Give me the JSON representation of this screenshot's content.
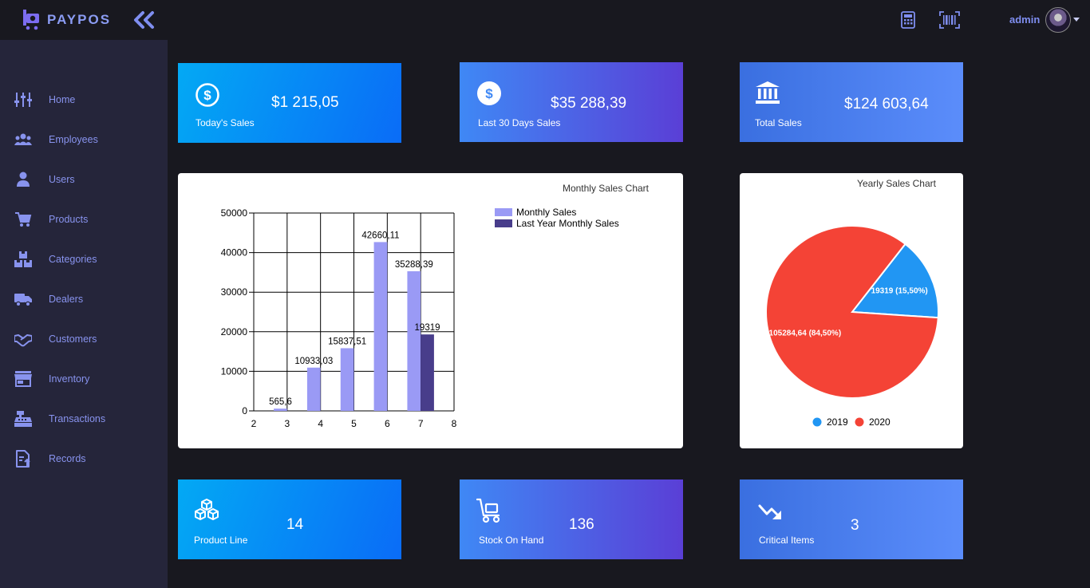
{
  "app": {
    "brand": "PAYPOS"
  },
  "topbar": {
    "user_name": "admin",
    "icons": [
      "calculator-icon",
      "barcode-icon"
    ]
  },
  "sidebar": {
    "items": [
      {
        "label": "Home",
        "icon": "sliders-icon"
      },
      {
        "label": "Employees",
        "icon": "people-icon"
      },
      {
        "label": "Users",
        "icon": "person-icon"
      },
      {
        "label": "Products",
        "icon": "cart-icon"
      },
      {
        "label": "Categories",
        "icon": "boxes-icon"
      },
      {
        "label": "Dealers",
        "icon": "truck-icon"
      },
      {
        "label": "Customers",
        "icon": "handshake-icon"
      },
      {
        "label": "Inventory",
        "icon": "store-icon"
      },
      {
        "label": "Transactions",
        "icon": "cash-register-icon"
      },
      {
        "label": "Records",
        "icon": "file-upload-icon"
      }
    ]
  },
  "cards_top": [
    {
      "label": "Today's Sales",
      "value": "$1 215,05",
      "icon": "dollar-circle-icon"
    },
    {
      "label": "Last 30 Days Sales",
      "value": "$35 288,39",
      "icon": "dollar-coin-icon"
    },
    {
      "label": "Total Sales",
      "value": "$124 603,64",
      "icon": "bank-icon"
    }
  ],
  "cards_bottom": [
    {
      "label": "Product Line",
      "value": "14",
      "icon": "cubes-icon"
    },
    {
      "label": "Stock On Hand",
      "value": "136",
      "icon": "dolly-icon"
    },
    {
      "label": "Critical Items",
      "value": "3",
      "icon": "trend-down-icon"
    }
  ],
  "colors": {
    "page_bg": "#18181f",
    "sidebar_bg": "#25253a",
    "nav_text": "#8893ee",
    "bar_monthly": "#9a9af5",
    "bar_last_year": "#483d8b",
    "pie_2019": "#2196f3",
    "pie_2020": "#f44336"
  },
  "chart_data": [
    {
      "type": "bar",
      "title": "Monthly Sales Chart",
      "x_ticks": [
        "2",
        "3",
        "4",
        "5",
        "6",
        "7",
        "8"
      ],
      "y_ticks": [
        "0",
        "10000",
        "20000",
        "30000",
        "40000",
        "50000"
      ],
      "xlim": [
        2,
        8
      ],
      "ylim": [
        0,
        50000
      ],
      "grid": true,
      "legend_position": "top-right",
      "series": [
        {
          "name": "Monthly Sales",
          "color": "#9a9af5",
          "points": [
            {
              "x": 3,
              "y": 565.6,
              "label": "565,6"
            },
            {
              "x": 4,
              "y": 10933.03,
              "label": "10933,03"
            },
            {
              "x": 5,
              "y": 15837.51,
              "label": "15837,51"
            },
            {
              "x": 6,
              "y": 42660.11,
              "label": "42660,11"
            },
            {
              "x": 7,
              "y": 35288.39,
              "label": "35288,39"
            }
          ]
        },
        {
          "name": "Last Year Monthly Sales",
          "color": "#483d8b",
          "points": [
            {
              "x": 7,
              "y": 19319,
              "label": "19319"
            }
          ]
        }
      ]
    },
    {
      "type": "pie",
      "title": "Yearly Sales Chart",
      "legend_position": "bottom",
      "slices": [
        {
          "name": "2019",
          "value": 19319,
          "percent": 15.5,
          "label": "19319 (15,50%)",
          "color": "#2196f3"
        },
        {
          "name": "2020",
          "value": 105284.64,
          "percent": 84.5,
          "label": "105284,64 (84,50%)",
          "color": "#f44336"
        }
      ]
    }
  ]
}
